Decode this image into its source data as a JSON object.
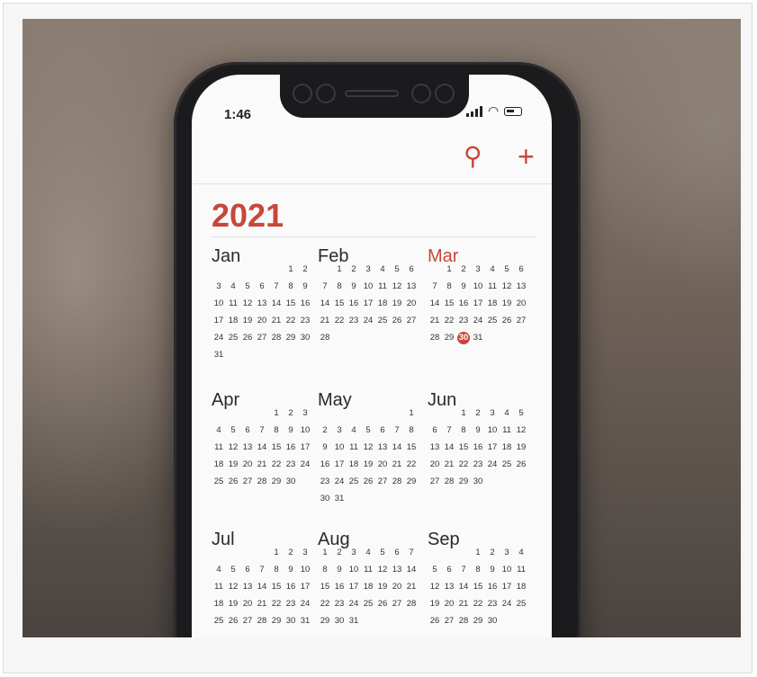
{
  "status_bar": {
    "time": "1:46"
  },
  "toolbar": {
    "search_icon": "search-icon",
    "add_icon": "plus-icon",
    "search_glyph": "⚲",
    "add_glyph": "+"
  },
  "colors": {
    "accent": "#c9473a",
    "text": "#2a2a2a"
  },
  "calendar": {
    "year": "2021",
    "today": {
      "month": 2,
      "day": "30"
    },
    "months": [
      {
        "name": "Jan",
        "offset": 5,
        "days": 31
      },
      {
        "name": "Feb",
        "offset": 1,
        "days": 28
      },
      {
        "name": "Mar",
        "offset": 1,
        "days": 31
      },
      {
        "name": "Apr",
        "offset": 4,
        "days": 30
      },
      {
        "name": "May",
        "offset": 6,
        "days": 31
      },
      {
        "name": "Jun",
        "offset": 2,
        "days": 30
      },
      {
        "name": "Jul",
        "offset": 4,
        "days": 31
      },
      {
        "name": "Aug",
        "offset": 0,
        "days": 31
      },
      {
        "name": "Sep",
        "offset": 3,
        "days": 30
      }
    ]
  }
}
